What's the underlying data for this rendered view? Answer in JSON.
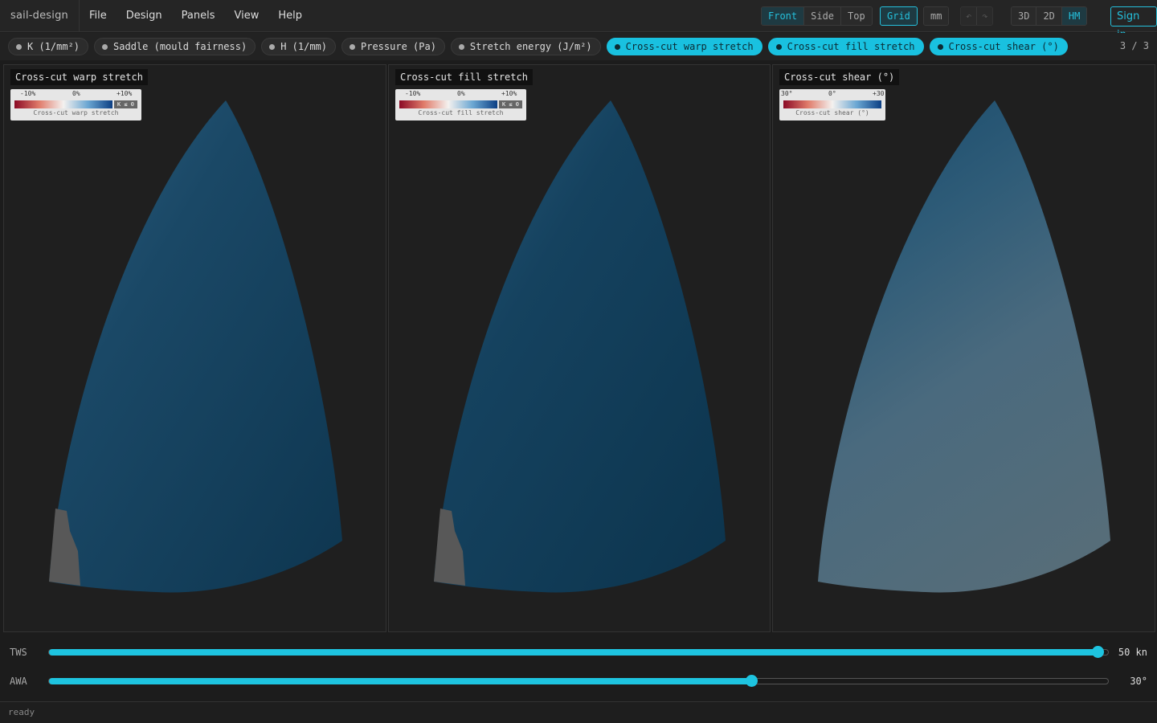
{
  "app": {
    "brand": "sail-design"
  },
  "menu": [
    "File",
    "Design",
    "Panels",
    "View",
    "Help"
  ],
  "toolbar": {
    "views": [
      {
        "label": "Front",
        "active": true
      },
      {
        "label": "Side",
        "active": false
      },
      {
        "label": "Top",
        "active": false
      }
    ],
    "grid_label": "Grid",
    "grid_active": true,
    "units_label": "mm",
    "undo_icon": "undo-icon",
    "redo_icon": "redo-icon",
    "modes": [
      {
        "label": "3D",
        "active": false
      },
      {
        "label": "2D",
        "active": false
      },
      {
        "label": "HM",
        "active": true
      }
    ],
    "sign_in": "Sign in"
  },
  "layers": [
    {
      "label": "K (1/mm²)",
      "active": false
    },
    {
      "label": "Saddle (mould fairness)",
      "active": false
    },
    {
      "label": "H (1/mm)",
      "active": false
    },
    {
      "label": "Pressure (Pa)",
      "active": false
    },
    {
      "label": "Stretch energy (J/m²)",
      "active": false
    },
    {
      "label": "Cross-cut warp stretch",
      "active": true
    },
    {
      "label": "Cross-cut fill stretch",
      "active": true
    },
    {
      "label": "Cross-cut shear (°)",
      "active": true
    }
  ],
  "page_count": "3 / 3",
  "panels": [
    {
      "title": "Cross-cut warp stretch",
      "legend": {
        "min": "-10%",
        "mid": "0%",
        "max": "+10%",
        "tag": "K ≤ 0",
        "caption": "Cross-cut warp stretch"
      }
    },
    {
      "title": "Cross-cut fill stretch",
      "legend": {
        "min": "-10%",
        "mid": "0%",
        "max": "+10%",
        "tag": "K ≤ 0",
        "caption": "Cross-cut fill stretch"
      }
    },
    {
      "title": "Cross-cut shear (°)",
      "legend": {
        "min": "30°",
        "mid": "0°",
        "max": "+30",
        "tag": "",
        "caption": "Cross-cut shear (°)"
      }
    }
  ],
  "colors": {
    "accent": "#1ec4e0",
    "sail_dark": "#0f3a55",
    "sail_shear": "#4d6878"
  },
  "sliders": [
    {
      "label": "TWS",
      "value": "50 kn",
      "fraction": 0.99
    },
    {
      "label": "AWA",
      "value": "30°",
      "fraction": 0.663
    }
  ],
  "status": "ready"
}
